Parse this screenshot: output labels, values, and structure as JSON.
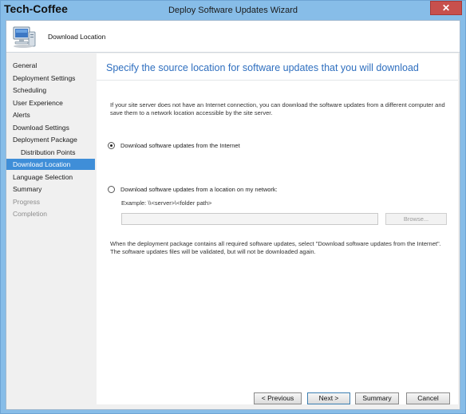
{
  "window": {
    "brand": "Tech-Coffee",
    "title": "Deploy Software Updates Wizard",
    "close_label": "✕"
  },
  "header": {
    "title": "Download Location",
    "icon": "computer-icon"
  },
  "nav": {
    "items": [
      {
        "label": "General",
        "state": "normal"
      },
      {
        "label": "Deployment Settings",
        "state": "normal"
      },
      {
        "label": "Scheduling",
        "state": "normal"
      },
      {
        "label": "User Experience",
        "state": "normal"
      },
      {
        "label": "Alerts",
        "state": "normal"
      },
      {
        "label": "Download Settings",
        "state": "normal"
      },
      {
        "label": "Deployment Package",
        "state": "normal"
      },
      {
        "label": "Distribution Points",
        "state": "sub"
      },
      {
        "label": "Download Location",
        "state": "active"
      },
      {
        "label": "Language Selection",
        "state": "normal"
      },
      {
        "label": "Summary",
        "state": "normal"
      },
      {
        "label": "Progress",
        "state": "disabled"
      },
      {
        "label": "Completion",
        "state": "disabled"
      }
    ]
  },
  "main": {
    "heading": "Specify the source location for software updates that you will download",
    "description": "If your site server does not have an Internet connection, you can download the software updates from a different computer and save them to a network location accessible by the site server.",
    "option_internet": "Download software updates from the Internet",
    "option_network": "Download software updates from a location on my network:",
    "selected_option": "internet",
    "example": "Example: \\\\<server>\\<folder path>",
    "path_value": "",
    "browse_label": "Browse...",
    "note": "When the deployment package contains all required software updates, select \"Download  software updates from the Internet\". The software updates files will be validated, but will not be downloaded again."
  },
  "buttons": {
    "previous": "< Previous",
    "next": "Next >",
    "summary": "Summary",
    "cancel": "Cancel"
  },
  "colors": {
    "titlebar": "#87bde8",
    "active_nav": "#3f8ed8",
    "heading": "#2f6fbf"
  }
}
